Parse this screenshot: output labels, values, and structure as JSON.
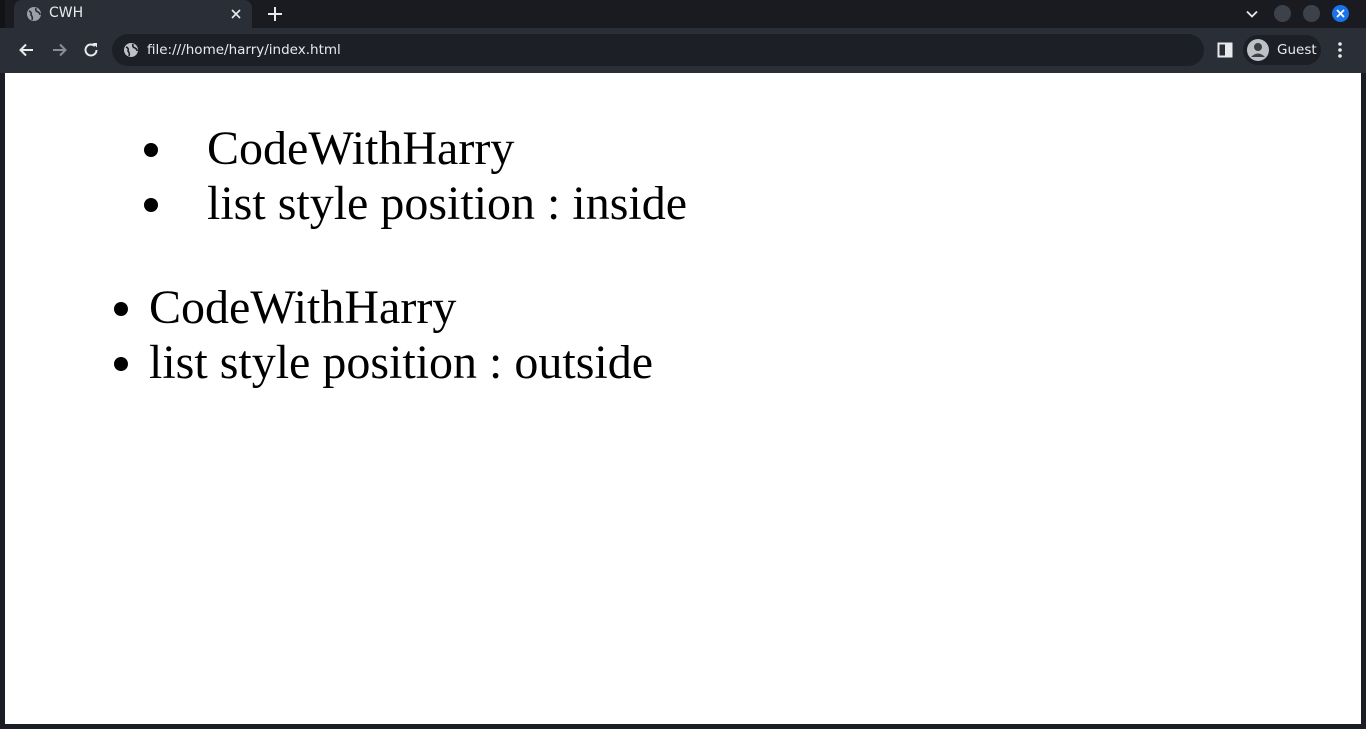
{
  "browser": {
    "tab": {
      "title": "CWH",
      "favicon": "globe-icon"
    },
    "toolbar": {
      "url": "file:///home/harry/index.html",
      "profile_label": "Guest",
      "icons": [
        "back-arrow-icon",
        "forward-arrow-icon",
        "reload-icon",
        "site-info-icon",
        "side-panel-icon",
        "avatar-icon",
        "more-menu-icon"
      ]
    },
    "window_controls": [
      "minimize",
      "maximize",
      "close"
    ],
    "colors": {
      "frame": "#191b21",
      "toolbar": "#2a2e37",
      "omnibox": "#1c1f25",
      "close_accent": "#1a73e8"
    }
  },
  "page": {
    "list_inside": {
      "items": [
        "CodeWithHarry",
        "list style position : inside"
      ]
    },
    "list_outside": {
      "items": [
        "CodeWithHarry",
        "list style position : outside"
      ]
    }
  }
}
